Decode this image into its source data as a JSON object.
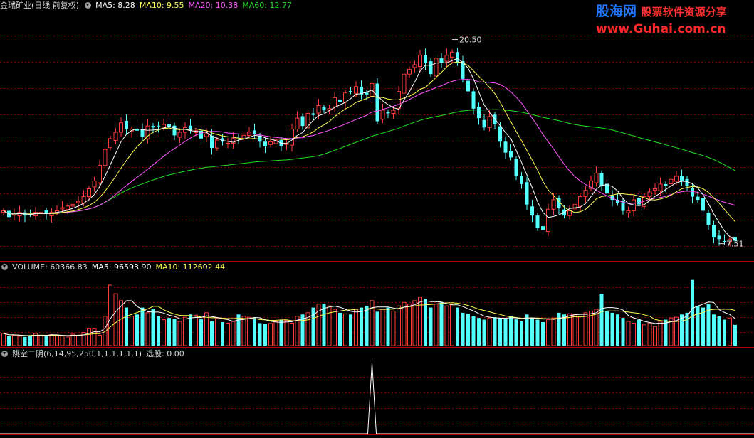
{
  "header": {
    "title": "金瑞矿业(日线 前复权)",
    "ma5": "MA5: 8.28",
    "ma10": "MA10: 9.55",
    "ma20": "MA20: 10.38",
    "ma60": "MA60: 12.77"
  },
  "volume_header": {
    "title": "VOLUME: 60366.83",
    "ma5": "MA5: 96593.90",
    "ma10": "MA10: 112602.44"
  },
  "indicator_header": {
    "title": "跳空二阴(6,14,95,250,1,1,1,1,1,1)",
    "value": "选股: 0.00"
  },
  "watermark": {
    "brand": "股海网",
    "slogan": "股票软件资源分享",
    "url": "www.Guhai.com.cn"
  },
  "colors": {
    "up": "#ff3b3b",
    "down": "#54ffff",
    "ma5": "#ffffff",
    "ma10": "#ffff55",
    "ma20": "#ff55ff",
    "ma60": "#22dd22",
    "grid": "#8b0000"
  },
  "chart_data": [
    {
      "type": "candlestick",
      "name": "price",
      "annotations": [
        {
          "text": "20.50",
          "x": 84,
          "y": 20.5
        },
        {
          "text": "7.51",
          "x": 134,
          "y": 7.51
        }
      ],
      "ylim": [
        6.5,
        22.2
      ],
      "close": [
        9.6,
        9.2,
        9.4,
        9.5,
        9.3,
        9.4,
        9.5,
        9.5,
        9.4,
        9.5,
        9.6,
        9.8,
        9.9,
        10.0,
        10.2,
        10.5,
        11.0,
        11.5,
        12.5,
        13.5,
        14.2,
        14.6,
        15.2,
        14.8,
        14.8,
        14.7,
        14.3,
        15.0,
        14.9,
        15.0,
        15.1,
        14.9,
        14.4,
        14.6,
        14.9,
        14.7,
        14.7,
        14.2,
        14.5,
        13.6,
        14.1,
        14.0,
        13.9,
        14.2,
        14.3,
        14.4,
        14.6,
        14.5,
        14.0,
        13.7,
        14.0,
        14.1,
        13.7,
        13.9,
        14.8,
        15.5,
        15.0,
        15.8,
        15.7,
        16.3,
        16.0,
        16.1,
        16.8,
        16.5,
        17.1,
        17.2,
        17.5,
        17.0,
        17.0,
        17.7,
        15.3,
        16.0,
        15.8,
        16.0,
        17.2,
        18.3,
        18.6,
        18.9,
        19.5,
        19.0,
        18.3,
        19.3,
        19.0,
        19.5,
        19.7,
        19.0,
        18.0,
        17.2,
        16.1,
        15.5,
        14.9,
        15.6,
        15.1,
        14.0,
        13.3,
        13.0,
        11.8,
        11.3,
        10.0,
        9.3,
        8.5,
        8.4,
        9.7,
        10.3,
        9.8,
        9.3,
        9.6,
        10.0,
        10.5,
        10.9,
        11.5,
        12.0,
        11.2,
        10.7,
        10.3,
        10.1,
        9.6,
        9.6,
        10.3,
        10.0,
        10.5,
        10.8,
        11.0,
        11.3,
        11.2,
        11.6,
        11.8,
        11.5,
        11.2,
        10.5,
        10.3,
        9.6,
        8.7,
        7.9,
        7.8,
        7.6,
        7.8,
        7.7
      ]
    },
    {
      "type": "bar",
      "name": "volume",
      "ylim": [
        0,
        210000
      ],
      "values": [
        35000,
        28000,
        30000,
        27000,
        25000,
        30000,
        35000,
        30000,
        28000,
        32000,
        30000,
        28000,
        25000,
        33000,
        30000,
        38000,
        50000,
        50000,
        30000,
        85000,
        175000,
        150000,
        130000,
        110000,
        85000,
        90000,
        110000,
        95000,
        105000,
        85000,
        75000,
        80000,
        78000,
        70000,
        82000,
        90000,
        88000,
        76000,
        95000,
        70000,
        78000,
        68000,
        65000,
        70000,
        90000,
        85000,
        82000,
        80000,
        65000,
        62000,
        64000,
        70000,
        75000,
        72000,
        65000,
        85000,
        90000,
        95000,
        110000,
        120000,
        120000,
        115000,
        105000,
        95000,
        92000,
        90000,
        105000,
        110000,
        115000,
        130000,
        98000,
        105000,
        110000,
        100000,
        115000,
        125000,
        120000,
        130000,
        140000,
        135000,
        110000,
        120000,
        125000,
        115000,
        120000,
        110000,
        95000,
        92000,
        85000,
        80000,
        75000,
        80000,
        82000,
        80000,
        78000,
        85000,
        76000,
        70000,
        90000,
        80000,
        75000,
        68000,
        75000,
        80000,
        95000,
        90000,
        92000,
        90000,
        85000,
        95000,
        100000,
        105000,
        150000,
        100000,
        95000,
        90000,
        80000,
        70000,
        65000,
        75000,
        60000,
        65000,
        55000,
        70000,
        75000,
        80000,
        82000,
        90000,
        95000,
        190000,
        115000,
        110000,
        120000,
        90000,
        85000,
        75000,
        80000,
        60000
      ]
    },
    {
      "type": "line",
      "name": "跳空二阴",
      "spike_index": 69,
      "values": [
        0,
        1
      ]
    }
  ]
}
